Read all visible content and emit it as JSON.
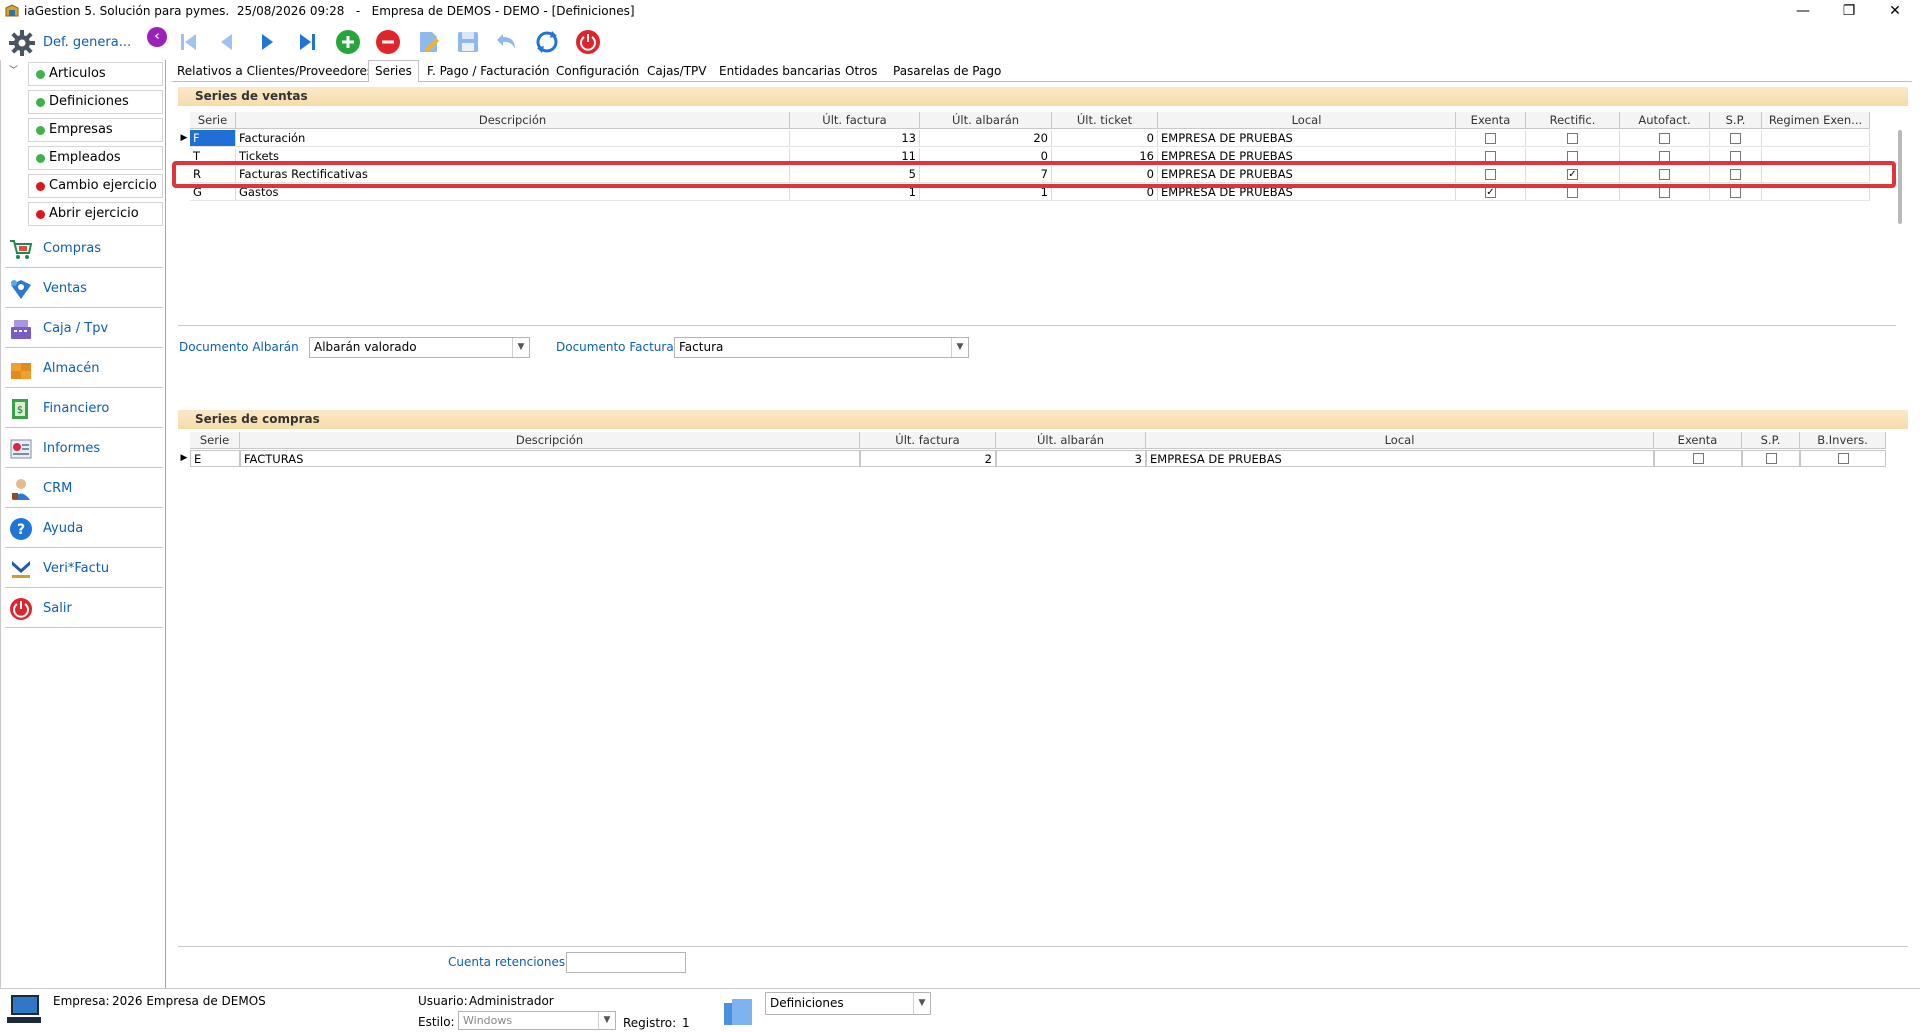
{
  "window": {
    "title": "iaGestion 5. Solución para pymes.  25/08/2026 09:28   -   Empresa de DEMOS - DEMO - [Definiciones]",
    "minimize": "—",
    "maximize": "❐",
    "close": "✕"
  },
  "header": {
    "section_label": "Def. genera...",
    "collapse_glyph": "‹"
  },
  "toolbar_icons": [
    "first-record-icon",
    "prev-record-icon",
    "next-record-icon",
    "last-record-icon",
    "add-record-icon",
    "delete-record-icon",
    "edit-record-icon",
    "save-record-icon",
    "undo-icon",
    "refresh-icon",
    "power-icon"
  ],
  "sidebar": {
    "sub_items": [
      {
        "label": "Articulos",
        "color": "#3fb24a"
      },
      {
        "label": "Definiciones",
        "color": "#3fb24a"
      },
      {
        "label": "Empresas",
        "color": "#3fb24a"
      },
      {
        "label": "Empleados",
        "color": "#3fb24a"
      },
      {
        "label": "Cambio ejercicio",
        "color": "#e0141e"
      },
      {
        "label": "Abrir ejercicio",
        "color": "#e0141e"
      }
    ],
    "main_items": [
      {
        "label": "Compras",
        "icon": "cart-icon"
      },
      {
        "label": "Ventas",
        "icon": "sales-icon"
      },
      {
        "label": "Caja / Tpv",
        "icon": "cash-register-icon"
      },
      {
        "label": "Almacén",
        "icon": "warehouse-icon"
      },
      {
        "label": "Financiero",
        "icon": "finance-icon"
      },
      {
        "label": "Informes",
        "icon": "reports-icon"
      },
      {
        "label": "CRM",
        "icon": "crm-icon"
      },
      {
        "label": "Ayuda",
        "icon": "help-icon"
      },
      {
        "label": "Veri*Factu",
        "icon": "verifactu-icon"
      },
      {
        "label": "Salir",
        "icon": "exit-icon"
      }
    ]
  },
  "tabs": [
    {
      "label": "Relativos a Clientes/Proveedores"
    },
    {
      "label": "Series"
    },
    {
      "label": "F. Pago / Facturación"
    },
    {
      "label": "Configuración"
    },
    {
      "label": "Cajas/TPV"
    },
    {
      "label": "Entidades bancarias"
    },
    {
      "label": "Otros"
    },
    {
      "label": "Pasarelas de Pago"
    }
  ],
  "active_tab": "Series",
  "sales_series": {
    "title": "Series de ventas",
    "columns": [
      "Serie",
      "Descripción",
      "Últ. factura",
      "Últ. albarán",
      "Últ. ticket",
      "Local",
      "Exenta",
      "Rectific.",
      "Autofact.",
      "S.P.",
      "Regimen Exen..."
    ],
    "rows": [
      {
        "serie": "F",
        "descripcion": "Facturación",
        "ult_factura": "13",
        "ult_albaran": "20",
        "ult_ticket": "0",
        "local": "EMPRESA DE PRUEBAS",
        "exenta": false,
        "rectific": false,
        "autofact": false,
        "sp": false,
        "regimen": ""
      },
      {
        "serie": "T",
        "descripcion": "Tickets",
        "ult_factura": "11",
        "ult_albaran": "0",
        "ult_ticket": "16",
        "local": "EMPRESA DE PRUEBAS",
        "exenta": false,
        "rectific": false,
        "autofact": false,
        "sp": false,
        "regimen": ""
      },
      {
        "serie": "R",
        "descripcion": "Facturas Rectificativas",
        "ult_factura": "5",
        "ult_albaran": "7",
        "ult_ticket": "0",
        "local": "EMPRESA DE PRUEBAS",
        "exenta": false,
        "rectific": true,
        "autofact": false,
        "sp": false,
        "regimen": ""
      },
      {
        "serie": "G",
        "descripcion": "Gastos",
        "ult_factura": "1",
        "ult_albaran": "1",
        "ult_ticket": "0",
        "local": "EMPRESA DE PRUEBAS",
        "exenta": true,
        "rectific": false,
        "autofact": false,
        "sp": false,
        "regimen": ""
      }
    ]
  },
  "documents": {
    "albaran_label": "Documento Albarán",
    "albaran_value": "Albarán valorado",
    "factura_label": "Documento Factura",
    "factura_value": "Factura"
  },
  "purchase_series": {
    "title": "Series de compras",
    "columns": [
      "Serie",
      "Descripción",
      "Últ. factura",
      "Últ. albarán",
      "Local",
      "Exenta",
      "S.P.",
      "B.Invers."
    ],
    "rows": [
      {
        "serie": "E",
        "descripcion": "FACTURAS",
        "ult_factura": "2",
        "ult_albaran": "3",
        "local": "EMPRESA DE PRUEBAS",
        "exenta": false,
        "sp": false,
        "binvers": false
      }
    ]
  },
  "retenciones": {
    "label": "Cuenta retenciones",
    "value": ""
  },
  "status": {
    "empresa_label": "Empresa:",
    "empresa_value": "2026 Empresa de DEMOS",
    "usuario_label": "Usuario:",
    "usuario_value": "Administrador",
    "estilo_label": "Estilo:",
    "estilo_value": "Windows",
    "registro_label": "Registro:",
    "registro_value": "1",
    "module_value": "Definiciones"
  },
  "colors": {
    "accent": "#0a5fb4",
    "highlight": "#e0343c",
    "section": "#f5dcaa"
  }
}
